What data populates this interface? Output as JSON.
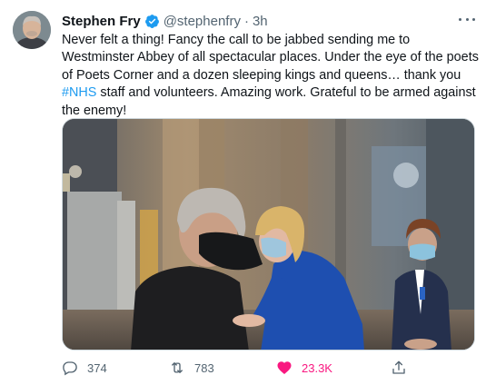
{
  "tweet": {
    "author": {
      "display_name": "Stephen Fry",
      "handle": "@stephenfry",
      "separator": "·",
      "time": "3h",
      "verified": true,
      "avatar_icon": "profile-photo"
    },
    "text": {
      "part1": "Never felt a thing! Fancy the call to be jabbed sending me to Westminster Abbey of all spectacular places. Under the eye of the poets of Poets Corner and a dozen sleeping kings and queens… thank you ",
      "hashtag": "#NHS",
      "part2": " staff and volunteers. Amazing work. Grateful to be armed against the enemy!"
    },
    "media": {
      "type": "photo",
      "alt": "Man in mask receiving vaccination from woman in blue dress inside Westminster Abbey"
    },
    "actions": {
      "reply": {
        "count": "374",
        "icon": "reply-icon"
      },
      "retweet": {
        "count": "783",
        "icon": "retweet-icon"
      },
      "like": {
        "count": "23.3K",
        "icon": "heart-icon",
        "liked": true
      },
      "share": {
        "icon": "share-icon"
      }
    },
    "more_icon": "more-icon"
  },
  "colors": {
    "accent": "#1d9bf0",
    "like": "#f91880",
    "muted": "#536471",
    "text": "#0f1419"
  }
}
